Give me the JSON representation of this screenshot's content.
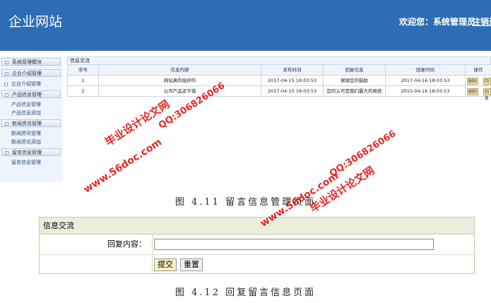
{
  "header": {
    "site_title": "企业网站",
    "welcome": "欢迎您：系统管理员",
    "logout": "注销退出"
  },
  "sidebar": {
    "items": [
      {
        "label": "系统管理模块",
        "group": true
      },
      {
        "label": "企业介绍管理",
        "group": true
      },
      {
        "label": "企业介绍管理",
        "group": false
      },
      {
        "label": "产品信息管理",
        "group": true
      },
      {
        "label": "产品信息管理",
        "group": false
      },
      {
        "label": "产品信息添加",
        "group": false
      },
      {
        "label": "新闻资讯管理",
        "group": true
      },
      {
        "label": "新闻资讯管理",
        "group": false
      },
      {
        "label": "新闻资讯添加",
        "group": false
      },
      {
        "label": "留言信息管理",
        "group": true
      },
      {
        "label": "留言信息管理",
        "group": false
      }
    ]
  },
  "panel": {
    "title": "信息交流",
    "columns": [
      "序号",
      "信息内容",
      "发布时间",
      "回复信息",
      "回复时间",
      "操作"
    ],
    "rows": [
      {
        "no": "1",
        "content": "网站真的挺好的",
        "time": "2017-04-15 18:03:53",
        "reply": "谢谢您的鼓励",
        "reply_time": "2017-04-16 18:03:53",
        "actions": [
          "删除",
          "回复"
        ]
      },
      {
        "no": "2",
        "content": "公司产品还不错",
        "time": "2017-04-15 18:03:53",
        "reply": "您的认可是我们最大的映获",
        "reply_time": "2015-04-16 18:03:53",
        "actions": [
          "删除",
          "回复"
        ]
      }
    ]
  },
  "captions": {
    "fig1": "图 4.11 留言信息管理页面",
    "fig2": "图 4.12 回复留言信息页面"
  },
  "form": {
    "title": "信息交流",
    "label": "回复内容：",
    "value": "",
    "submit": "提交",
    "reset": "重置"
  },
  "watermarks": [
    "毕业设计论文网",
    "www.56doc.com",
    "QQ:306826066",
    "www.56doc.com",
    "QQ:306826066",
    "毕业设计论文网"
  ]
}
